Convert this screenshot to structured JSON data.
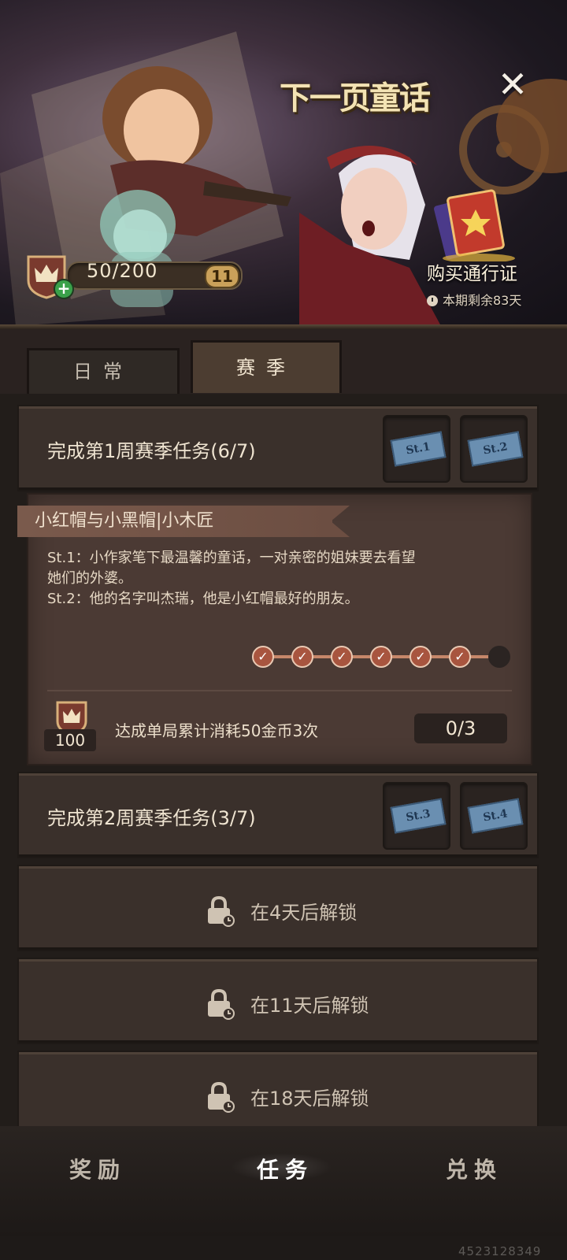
{
  "banner": {
    "title": "下一页童话",
    "close_symbol": "✕",
    "xp_text": "50/200",
    "level": "11",
    "buy_pass": "购买通行证",
    "remaining": "本期剩余83天"
  },
  "tabs": [
    {
      "label": "日常",
      "selected": false
    },
    {
      "label": "赛季",
      "selected": true
    }
  ],
  "weeks": [
    {
      "title": "完成第1周赛季任务(6/7)",
      "tickets": [
        "St.1",
        "St.2"
      ]
    },
    {
      "title": "完成第2周赛季任务(3/7)",
      "tickets": [
        "St.3",
        "St.4"
      ]
    }
  ],
  "detail": {
    "story_title": "小红帽与小黑帽|小木匠",
    "line1_a": "St.1：小作家笔下最温馨的童话，一对亲密的姐妹要去看望",
    "line1_b": "她们的外婆。",
    "line2": "St.2：他的名字叫杰瑞，他是小红帽最好的朋友。",
    "progress_done": 6,
    "progress_total": 7,
    "reward_amount": "100",
    "task_desc": "达成单局累计消耗50金币3次",
    "task_count": "0/3"
  },
  "locked": [
    {
      "text": "在4天后解锁"
    },
    {
      "text": "在11天后解锁"
    },
    {
      "text": "在18天后解锁"
    }
  ],
  "nav": [
    {
      "label": "奖励",
      "active": false
    },
    {
      "label": "任务",
      "active": true
    },
    {
      "label": "兑换",
      "active": false
    }
  ],
  "watermark": "4523128349",
  "colors": {
    "background": "#221d1a",
    "card": "#3a302b",
    "detail_card": "#4b3a34",
    "accent_red": "#a8553f",
    "ticket_blue": "#6a8fb1"
  }
}
